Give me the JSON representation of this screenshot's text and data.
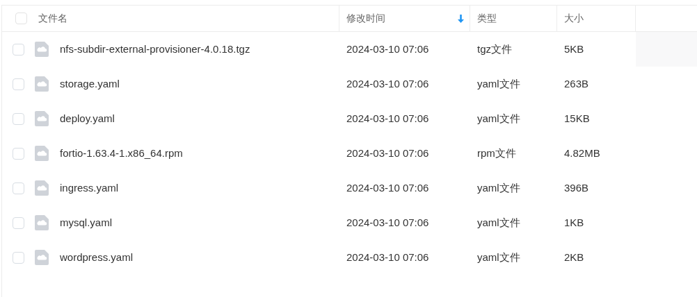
{
  "table": {
    "columns": [
      {
        "label": "文件名",
        "sorted": false
      },
      {
        "label": "修改时间",
        "sorted": true
      },
      {
        "label": "类型",
        "sorted": false
      },
      {
        "label": "大小",
        "sorted": false
      }
    ],
    "select_all": {
      "checked": false
    },
    "rows": [
      {
        "name": "nfs-subdir-external-provisioner-4.0.18.tgz",
        "modified": "2024-03-10 07:06",
        "type": "tgz文件",
        "size": "5KB",
        "checked": false,
        "hovered": true
      },
      {
        "name": "storage.yaml",
        "modified": "2024-03-10 07:06",
        "type": "yaml文件",
        "size": "263B",
        "checked": false,
        "hovered": false
      },
      {
        "name": "deploy.yaml",
        "modified": "2024-03-10 07:06",
        "type": "yaml文件",
        "size": "15KB",
        "checked": false,
        "hovered": false
      },
      {
        "name": "fortio-1.63.4-1.x86_64.rpm",
        "modified": "2024-03-10 07:06",
        "type": "rpm文件",
        "size": "4.82MB",
        "checked": false,
        "hovered": false
      },
      {
        "name": "ingress.yaml",
        "modified": "2024-03-10 07:06",
        "type": "yaml文件",
        "size": "396B",
        "checked": false,
        "hovered": false
      },
      {
        "name": "mysql.yaml",
        "modified": "2024-03-10 07:06",
        "type": "yaml文件",
        "size": "1KB",
        "checked": false,
        "hovered": false
      },
      {
        "name": "wordpress.yaml",
        "modified": "2024-03-10 07:06",
        "type": "yaml文件",
        "size": "2KB",
        "checked": false,
        "hovered": false
      }
    ]
  }
}
